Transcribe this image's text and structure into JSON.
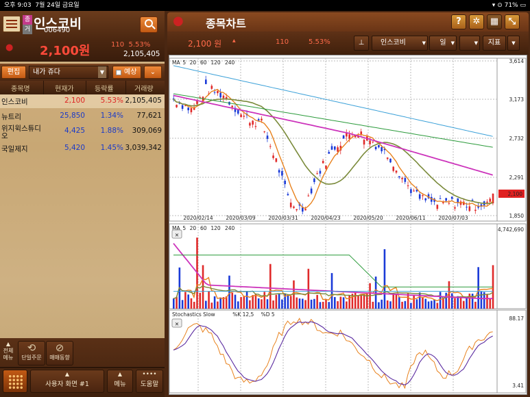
{
  "status": {
    "time": "오후 9:03",
    "date": "7월 24일 금요일",
    "battery": "71%"
  },
  "stock": {
    "name": "인스코비",
    "code": "006490",
    "badge_top": "종",
    "badge_bottom": "거",
    "price": "2,100원",
    "change": "110",
    "change_pct": "5.53%",
    "volume": "2,105,405"
  },
  "toolbar_left": {
    "edit_label": "편집",
    "group_label": "내가 쥬다",
    "forecast_label": "예상"
  },
  "table": {
    "headers": [
      "종목명",
      "현재가",
      "등락률",
      "거래량"
    ],
    "rows": [
      {
        "name": "인스코비",
        "price": "2,100",
        "pct": "5.53%",
        "vol": "2,105,405"
      },
      {
        "name": "뉴트리",
        "price": "25,850",
        "pct": "1.34%",
        "vol": "77,621"
      },
      {
        "name": "위지윅스튜디\n오",
        "price": "4,425",
        "pct": "1.88%",
        "vol": "309,069"
      },
      {
        "name": "국일제지",
        "price": "5,420",
        "pct": "1.45%",
        "vol": "3,039,342"
      }
    ]
  },
  "bottom_left": {
    "all_menu": "전체\n메뉴",
    "single_order": "단일주문",
    "trade_trend": "매매동향",
    "user_screen": "사용자 화면 #1",
    "menu": "메뉴",
    "help": "도움말"
  },
  "chart_header": {
    "title": "종목차트",
    "price": "2,100 원",
    "change": "110",
    "change_pct": "5.53%",
    "stock_select": "인스코비",
    "period": "일",
    "indicator": "지표"
  },
  "chart": {
    "ma_legend_price": [
      "MA",
      "5",
      "20",
      "60",
      "120",
      "240"
    ],
    "ma_legend_volume": [
      "MA",
      "5",
      "20",
      "60",
      "120",
      "240"
    ],
    "stoch_legend": [
      "Stochastics Slow",
      "%K 12,5",
      "%D 5"
    ],
    "price_ticks": [
      "3,614",
      "3,173",
      "2,732",
      "2,291",
      "1,850"
    ],
    "current_price_tag": "2,100",
    "x_labels": [
      "2020/02/14",
      "2020/03/09",
      "2020/03/31",
      "2020/04/23",
      "2020/05/20",
      "2020/06/11",
      "2020/07/03"
    ],
    "volume_max": "4,742,690",
    "stoch_max": "88.17",
    "stoch_min": "3.41",
    "colors": {
      "ma5": "#e8821e",
      "ma20": "#7a8a3a",
      "ma60": "#cc33bb",
      "ma120": "#2a9a3a",
      "ma240": "#3aa0d8",
      "up": "#e02a2a",
      "down": "#1a3ad8",
      "k": "#e8821e",
      "d": "#5a2aa0"
    }
  }
}
